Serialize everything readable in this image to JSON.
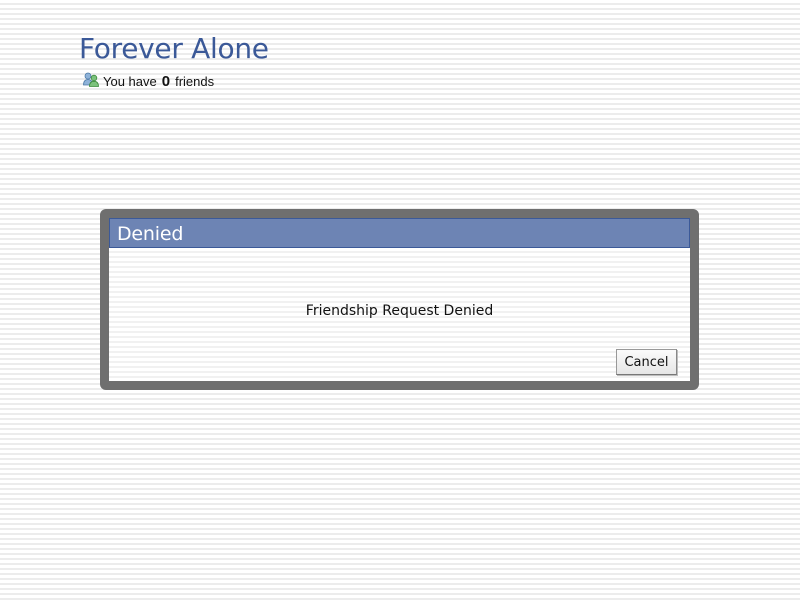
{
  "header": {
    "title": "Forever Alone",
    "friends_prefix": "You have",
    "friends_count": "0",
    "friends_suffix": "friends",
    "icon": "friends-icon"
  },
  "dialog": {
    "title": "Denied",
    "message": "Friendship Request Denied",
    "cancel_label": "Cancel"
  },
  "colors": {
    "title": "#3b5998",
    "dialog_header": "#6d84b4",
    "dialog_frame": "#6f6f6f"
  }
}
